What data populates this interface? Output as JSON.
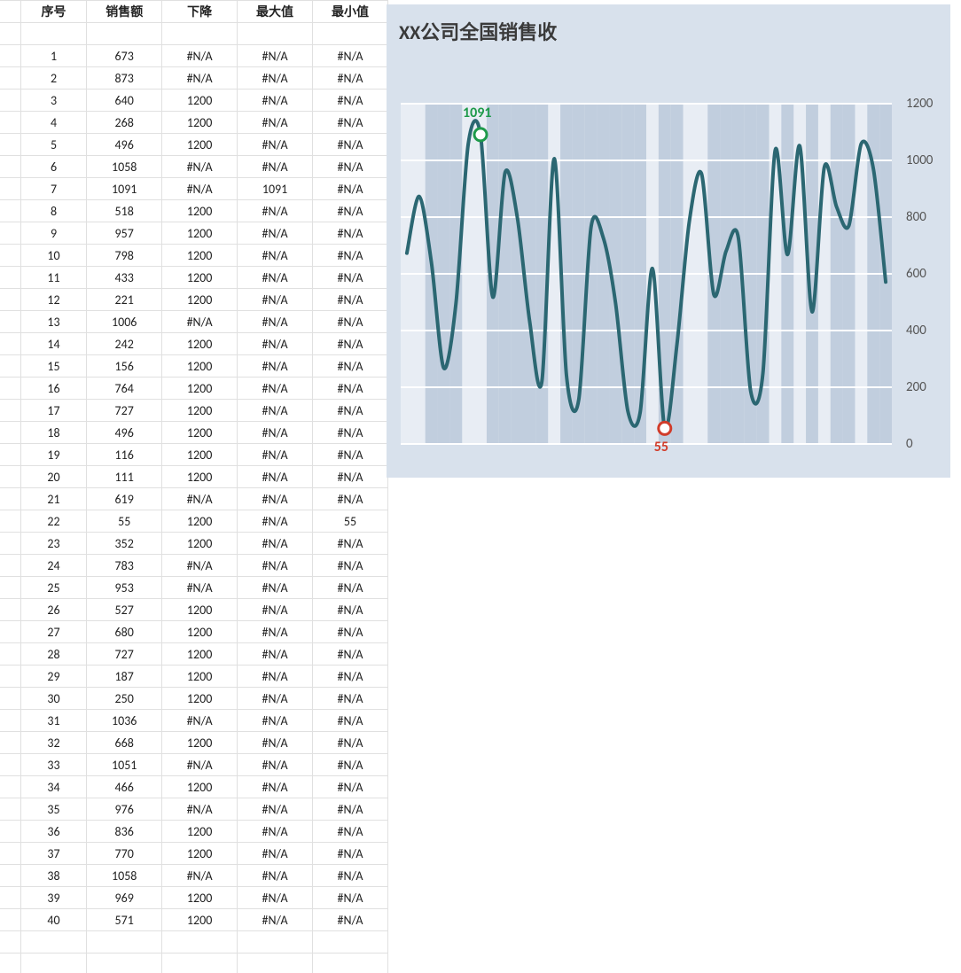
{
  "table": {
    "headers": [
      "序号",
      "销售额",
      "下降",
      "最大值",
      "最小值"
    ],
    "rows": [
      {
        "n": 1,
        "sales": 673,
        "down": "#N/A",
        "max": "#N/A",
        "min": "#N/A"
      },
      {
        "n": 2,
        "sales": 873,
        "down": "#N/A",
        "max": "#N/A",
        "min": "#N/A"
      },
      {
        "n": 3,
        "sales": 640,
        "down": 1200,
        "max": "#N/A",
        "min": "#N/A"
      },
      {
        "n": 4,
        "sales": 268,
        "down": 1200,
        "max": "#N/A",
        "min": "#N/A"
      },
      {
        "n": 5,
        "sales": 496,
        "down": 1200,
        "max": "#N/A",
        "min": "#N/A"
      },
      {
        "n": 6,
        "sales": 1058,
        "down": "#N/A",
        "max": "#N/A",
        "min": "#N/A"
      },
      {
        "n": 7,
        "sales": 1091,
        "down": "#N/A",
        "max": 1091,
        "min": "#N/A"
      },
      {
        "n": 8,
        "sales": 518,
        "down": 1200,
        "max": "#N/A",
        "min": "#N/A"
      },
      {
        "n": 9,
        "sales": 957,
        "down": 1200,
        "max": "#N/A",
        "min": "#N/A"
      },
      {
        "n": 10,
        "sales": 798,
        "down": 1200,
        "max": "#N/A",
        "min": "#N/A"
      },
      {
        "n": 11,
        "sales": 433,
        "down": 1200,
        "max": "#N/A",
        "min": "#N/A"
      },
      {
        "n": 12,
        "sales": 221,
        "down": 1200,
        "max": "#N/A",
        "min": "#N/A"
      },
      {
        "n": 13,
        "sales": 1006,
        "down": "#N/A",
        "max": "#N/A",
        "min": "#N/A"
      },
      {
        "n": 14,
        "sales": 242,
        "down": 1200,
        "max": "#N/A",
        "min": "#N/A"
      },
      {
        "n": 15,
        "sales": 156,
        "down": 1200,
        "max": "#N/A",
        "min": "#N/A"
      },
      {
        "n": 16,
        "sales": 764,
        "down": 1200,
        "max": "#N/A",
        "min": "#N/A"
      },
      {
        "n": 17,
        "sales": 727,
        "down": 1200,
        "max": "#N/A",
        "min": "#N/A"
      },
      {
        "n": 18,
        "sales": 496,
        "down": 1200,
        "max": "#N/A",
        "min": "#N/A"
      },
      {
        "n": 19,
        "sales": 116,
        "down": 1200,
        "max": "#N/A",
        "min": "#N/A"
      },
      {
        "n": 20,
        "sales": 111,
        "down": 1200,
        "max": "#N/A",
        "min": "#N/A"
      },
      {
        "n": 21,
        "sales": 619,
        "down": "#N/A",
        "max": "#N/A",
        "min": "#N/A"
      },
      {
        "n": 22,
        "sales": 55,
        "down": 1200,
        "max": "#N/A",
        "min": 55
      },
      {
        "n": 23,
        "sales": 352,
        "down": 1200,
        "max": "#N/A",
        "min": "#N/A"
      },
      {
        "n": 24,
        "sales": 783,
        "down": "#N/A",
        "max": "#N/A",
        "min": "#N/A"
      },
      {
        "n": 25,
        "sales": 953,
        "down": "#N/A",
        "max": "#N/A",
        "min": "#N/A"
      },
      {
        "n": 26,
        "sales": 527,
        "down": 1200,
        "max": "#N/A",
        "min": "#N/A"
      },
      {
        "n": 27,
        "sales": 680,
        "down": 1200,
        "max": "#N/A",
        "min": "#N/A"
      },
      {
        "n": 28,
        "sales": 727,
        "down": 1200,
        "max": "#N/A",
        "min": "#N/A"
      },
      {
        "n": 29,
        "sales": 187,
        "down": 1200,
        "max": "#N/A",
        "min": "#N/A"
      },
      {
        "n": 30,
        "sales": 250,
        "down": 1200,
        "max": "#N/A",
        "min": "#N/A"
      },
      {
        "n": 31,
        "sales": 1036,
        "down": "#N/A",
        "max": "#N/A",
        "min": "#N/A"
      },
      {
        "n": 32,
        "sales": 668,
        "down": 1200,
        "max": "#N/A",
        "min": "#N/A"
      },
      {
        "n": 33,
        "sales": 1051,
        "down": "#N/A",
        "max": "#N/A",
        "min": "#N/A"
      },
      {
        "n": 34,
        "sales": 466,
        "down": 1200,
        "max": "#N/A",
        "min": "#N/A"
      },
      {
        "n": 35,
        "sales": 976,
        "down": "#N/A",
        "max": "#N/A",
        "min": "#N/A"
      },
      {
        "n": 36,
        "sales": 836,
        "down": 1200,
        "max": "#N/A",
        "min": "#N/A"
      },
      {
        "n": 37,
        "sales": 770,
        "down": 1200,
        "max": "#N/A",
        "min": "#N/A"
      },
      {
        "n": 38,
        "sales": 1058,
        "down": "#N/A",
        "max": "#N/A",
        "min": "#N/A"
      },
      {
        "n": 39,
        "sales": 969,
        "down": 1200,
        "max": "#N/A",
        "min": "#N/A"
      },
      {
        "n": 40,
        "sales": 571,
        "down": 1200,
        "max": "#N/A",
        "min": "#N/A"
      }
    ]
  },
  "chart_data": {
    "type": "line",
    "title": "XX公司全国销售收",
    "ylim": [
      0,
      1200
    ],
    "yticks": [
      0,
      200,
      400,
      600,
      800,
      1000,
      1200
    ],
    "x": [
      1,
      2,
      3,
      4,
      5,
      6,
      7,
      8,
      9,
      10,
      11,
      12,
      13,
      14,
      15,
      16,
      17,
      18,
      19,
      20,
      21,
      22,
      23,
      24,
      25,
      26,
      27,
      28,
      29,
      30,
      31,
      32,
      33,
      34,
      35,
      36,
      37,
      38,
      39,
      40
    ],
    "series": [
      {
        "name": "销售额",
        "values": [
          673,
          873,
          640,
          268,
          496,
          1058,
          1091,
          518,
          957,
          798,
          433,
          221,
          1006,
          242,
          156,
          764,
          727,
          496,
          116,
          111,
          619,
          55,
          352,
          783,
          953,
          527,
          680,
          727,
          187,
          250,
          1036,
          668,
          1051,
          466,
          976,
          836,
          770,
          1058,
          969,
          571
        ],
        "color": "#2b6772"
      },
      {
        "name": "下降",
        "type": "bar",
        "values": [
          null,
          null,
          1200,
          1200,
          1200,
          null,
          null,
          1200,
          1200,
          1200,
          1200,
          1200,
          null,
          1200,
          1200,
          1200,
          1200,
          1200,
          1200,
          1200,
          null,
          1200,
          1200,
          null,
          null,
          1200,
          1200,
          1200,
          1200,
          1200,
          null,
          1200,
          null,
          1200,
          null,
          1200,
          1200,
          null,
          1200,
          1200
        ],
        "color": "#c1cede"
      },
      {
        "name": "最大值",
        "type": "marker",
        "values": [
          null,
          null,
          null,
          null,
          null,
          null,
          1091,
          null,
          null,
          null,
          null,
          null,
          null,
          null,
          null,
          null,
          null,
          null,
          null,
          null,
          null,
          null,
          null,
          null,
          null,
          null,
          null,
          null,
          null,
          null,
          null,
          null,
          null,
          null,
          null,
          null,
          null,
          null,
          null,
          null
        ],
        "color": "#1e9a4a",
        "label": "1091"
      },
      {
        "name": "最小值",
        "type": "marker",
        "values": [
          null,
          null,
          null,
          null,
          null,
          null,
          null,
          null,
          null,
          null,
          null,
          null,
          null,
          null,
          null,
          null,
          null,
          null,
          null,
          null,
          null,
          55,
          null,
          null,
          null,
          null,
          null,
          null,
          null,
          null,
          null,
          null,
          null,
          null,
          null,
          null,
          null,
          null,
          null,
          null
        ],
        "color": "#d13c2a",
        "label": "55"
      }
    ]
  }
}
